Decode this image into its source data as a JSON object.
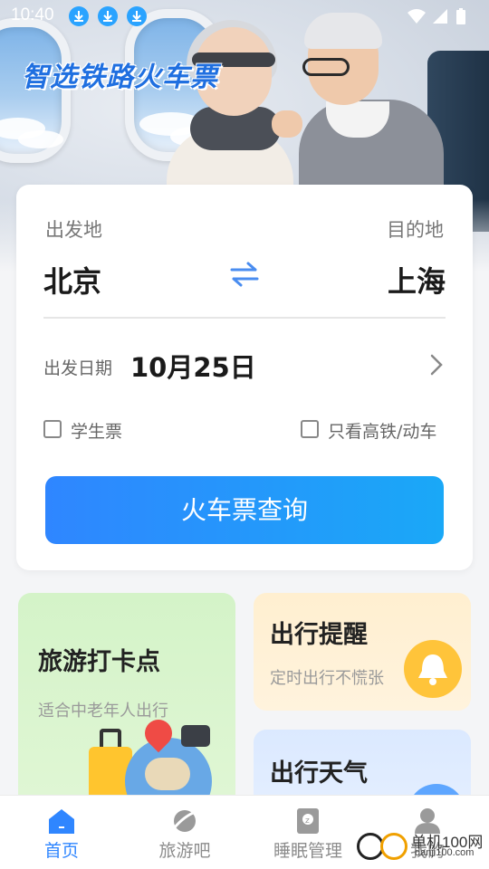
{
  "status_bar": {
    "time": "10:40"
  },
  "header": {
    "title": "智选铁路火车票"
  },
  "search": {
    "from_label": "出发地",
    "to_label": "目的地",
    "from_city": "北京",
    "to_city": "上海",
    "date_label": "出发日期",
    "date_value": "10月25日",
    "student_ticket": "学生票",
    "high_speed_only": "只看高铁/动车",
    "search_button": "火车票查询",
    "accent_color": "#2f86ff"
  },
  "tiles": {
    "travel": {
      "title": "旅游打卡点",
      "subtitle": "适合中老年人出行"
    },
    "remind": {
      "title": "出行提醒",
      "subtitle": "定时出行不慌张"
    },
    "weather": {
      "title": "出行天气"
    }
  },
  "nav": {
    "items": [
      {
        "label": "首页",
        "icon": "home-icon",
        "active": true
      },
      {
        "label": "旅游吧",
        "icon": "planet-icon",
        "active": false
      },
      {
        "label": "睡眠管理",
        "icon": "sleep-icon",
        "active": false
      },
      {
        "label": "我的",
        "icon": "user-icon",
        "active": false
      }
    ]
  },
  "watermark": {
    "text": "单机100网",
    "sub": "danji100.com"
  }
}
